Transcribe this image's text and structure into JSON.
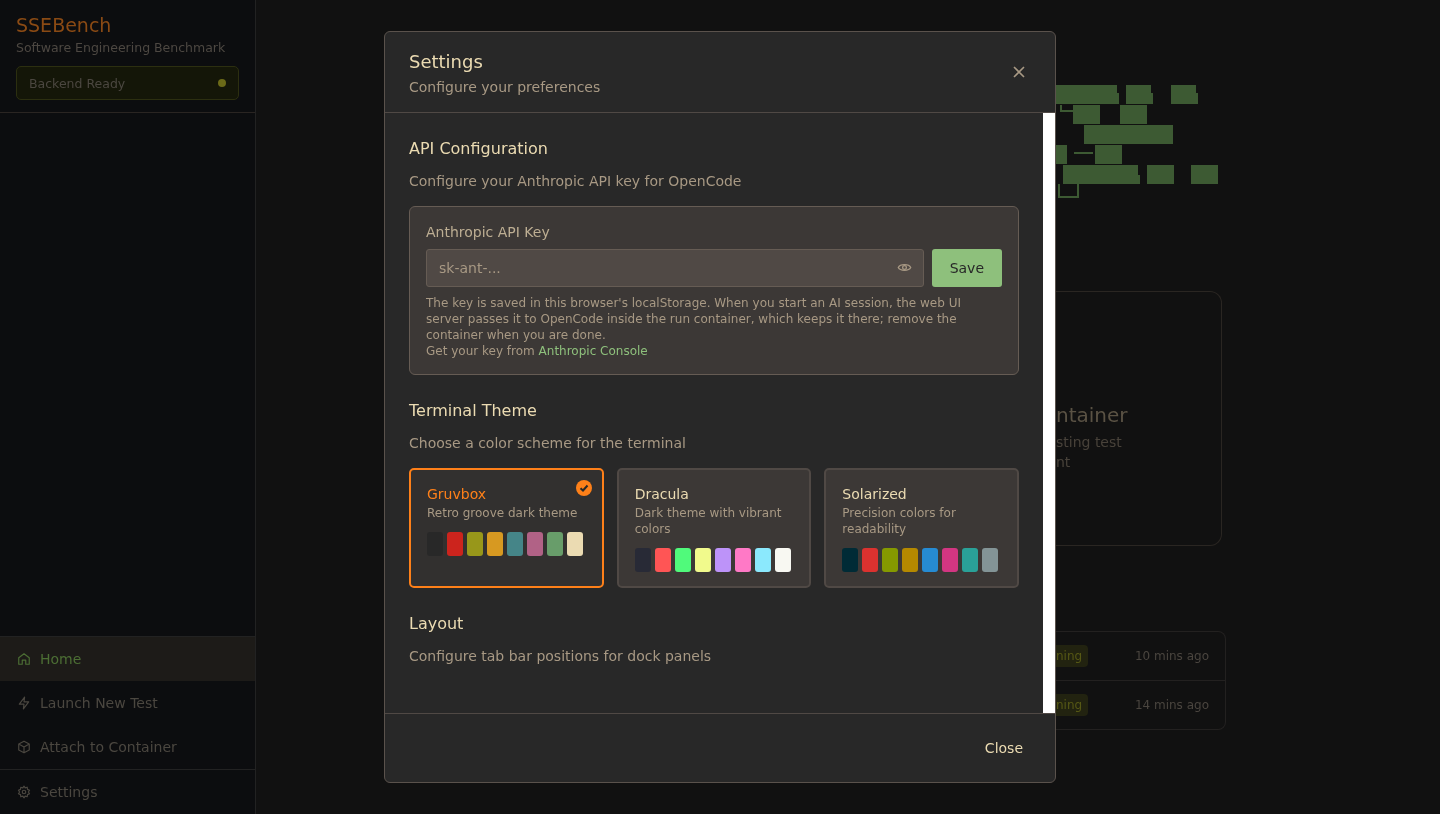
{
  "sidebar": {
    "title": "SSEBench",
    "subtitle": "Software Engineering Benchmark",
    "backend_status": {
      "label": "Backend Ready"
    },
    "items": [
      {
        "label": "Home",
        "selected": true
      },
      {
        "label": "Launch New Test",
        "selected": false
      },
      {
        "label": "Attach to Container",
        "selected": false
      }
    ],
    "footer_item": {
      "label": "Settings",
      "selected": false
    }
  },
  "background": {
    "card": {
      "title": "ntainer",
      "description_lines": [
        "sting test",
        "nt"
      ]
    },
    "rows": [
      {
        "status": "ning",
        "time": "10 mins ago"
      },
      {
        "status": "ning",
        "time": "14 mins ago"
      }
    ]
  },
  "dialog": {
    "title": "Settings",
    "subtitle": "Configure your preferences",
    "sections": [
      {
        "kind": "api",
        "title": "API Configuration",
        "description": "Configure your Anthropic API key for OpenCode",
        "field_label": "Anthropic API Key",
        "placeholder": "sk-ant-...",
        "button": "Save",
        "note": "The key is saved in this browser's localStorage. When you start an AI session, the web UI server passes it to OpenCode inside the run container, which keeps it there; remove the container when you are done.",
        "link_prefix": "Get your key from",
        "link": "Anthropic Console"
      },
      {
        "kind": "themes",
        "title": "Terminal Theme",
        "description": "Choose a color scheme for the terminal",
        "themes": [
          {
            "name": "Gruvbox",
            "description": "Retro groove dark theme",
            "selected": true,
            "swatches": [
              {
                "color": "#282828"
              },
              {
                "color": "#cc241d"
              },
              {
                "color": "#98971a"
              },
              {
                "color": "#d79921"
              },
              {
                "color": "#458588"
              },
              {
                "color": "#b16286"
              },
              {
                "color": "#689d6a"
              },
              {
                "color": "#ebdbb2"
              }
            ]
          },
          {
            "name": "Dracula",
            "description": "Dark theme with vibrant colors",
            "selected": false,
            "swatches": [
              {
                "color": "#282a36"
              },
              {
                "color": "#ff5555"
              },
              {
                "color": "#50fa7b"
              },
              {
                "color": "#f1fa8c"
              },
              {
                "color": "#bd93f9"
              },
              {
                "color": "#ff79c6"
              },
              {
                "color": "#8be9fd"
              },
              {
                "color": "#f8f8f2"
              }
            ]
          },
          {
            "name": "Solarized",
            "description": "Precision colors for readability",
            "selected": false,
            "swatches": [
              {
                "color": "#002b36"
              },
              {
                "color": "#dc322f"
              },
              {
                "color": "#859900"
              },
              {
                "color": "#b58900"
              },
              {
                "color": "#268bd2"
              },
              {
                "color": "#d33682"
              },
              {
                "color": "#2aa198"
              },
              {
                "color": "#839496"
              }
            ]
          }
        ]
      },
      {
        "kind": "plain",
        "title": "Layout",
        "description": "Configure tab bar positions for dock panels"
      }
    ],
    "footer_button": "Close"
  }
}
